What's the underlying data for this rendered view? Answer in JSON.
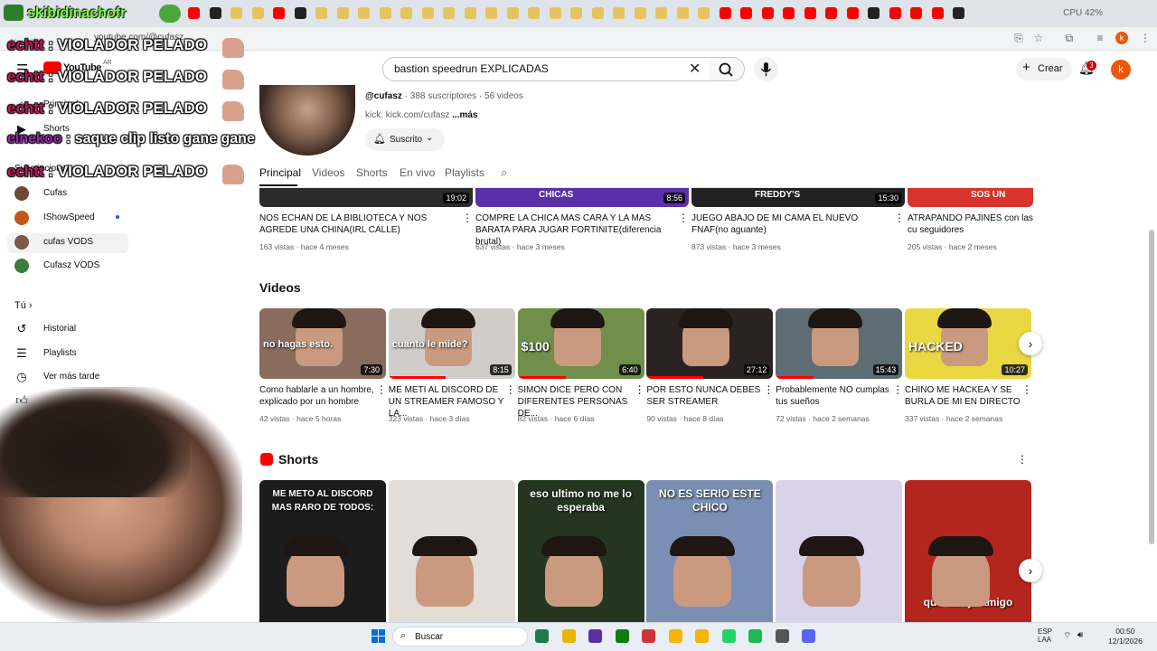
{
  "browser": {
    "stats": "CPU 42%",
    "url": "youtube.com/@cufasz"
  },
  "overlays": {
    "top_label": "skibidinachofr",
    "chat": [
      {
        "user": "echtt",
        "msg": " : VIOLADOR PELADO"
      },
      {
        "user": "echtt",
        "msg": " : VIOLADOR PELADO"
      },
      {
        "user": "echtt",
        "msg": " : VIOLADOR PELADO"
      },
      {
        "user": "elnekoo",
        "msg": " : saque clip listo gane gane"
      },
      {
        "user": "echtt",
        "msg": " : VIOLADOR PELADO"
      }
    ]
  },
  "youtube": {
    "logo": "YouTube",
    "logo_region": "AR",
    "search_value": "bastion speedrun EXPLICADAS",
    "create_label": "Crear",
    "notifications": "3",
    "avatar_letter": "k"
  },
  "sidebar": {
    "items_top": [
      {
        "label": "Principal",
        "icon": "home-icon"
      },
      {
        "label": "Shorts",
        "icon": "shorts-icon"
      }
    ],
    "subs_heading": "Suscripciones",
    "subscriptions": [
      {
        "label": "Cufas",
        "color": "#6b4a3a"
      },
      {
        "label": "IShowSpeed",
        "color": "#c2571a"
      },
      {
        "label": "cufas VODS",
        "color": "#7a5a48"
      },
      {
        "label": "Cufasz VODS",
        "color": "#3b7d3b"
      }
    ],
    "you_heading": "Tú",
    "you_items": [
      {
        "label": "Historial",
        "icon": "history-icon"
      },
      {
        "label": "Playlists",
        "icon": "playlists-icon"
      },
      {
        "label": "Ver más tarde",
        "icon": "watch-later-icon"
      }
    ]
  },
  "channel": {
    "handle": "@cufasz",
    "stats": " · 388 suscriptores · 56 videos",
    "kick": "kick: kick.com/cufasz ",
    "more": "...más",
    "subscribed": "Suscrito",
    "tabs": [
      "Principal",
      "Videos",
      "Shorts",
      "En vivo",
      "Playlists"
    ]
  },
  "row1": [
    {
      "duration": "19:02",
      "title": "NOS ECHAN DE LA BIBLIOTECA Y NOS AGREDE UNA CHINA(IRL CALLE)",
      "meta": "163 vistas · hace 4 meses",
      "color": "#2b2b2b"
    },
    {
      "duration": "8:56",
      "title": "COMPRE LA CHICA MAS CARA Y LA MAS BARATA PARA JUGAR FORTINITE(diferencia brutal)",
      "meta": "637 vistas · hace 3 meses",
      "color": "#5b2fa8",
      "overlay": "CHICAS"
    },
    {
      "duration": "15:30",
      "title": "JUEGO ABAJO DE MI CAMA EL NUEVO FNAF(no aguante)",
      "meta": "873 vistas · hace 3 meses",
      "color": "#222222",
      "overlay": "FREDDY'S"
    },
    {
      "duration": "",
      "title": "ATRAPANDO PAJINES con las cu seguidores",
      "meta": "205 vistas · hace 2 meses",
      "color": "#d8332c",
      "overlay": "SOS UN"
    }
  ],
  "videos_section": {
    "title": "Videos",
    "items": [
      {
        "duration": "7:30",
        "title": "Como hablarle a un hombre, explicado por un hombre",
        "meta": "42 vistas · hace 5 horas",
        "color": "#8a6c5e",
        "overlay": "no hagas esto.",
        "progress": 0
      },
      {
        "duration": "8:15",
        "title": "ME METI AL DISCORD DE UN STREAMER FAMOSO Y LA...",
        "meta": "323 vistas · hace 3 días",
        "color": "#d0cdc8",
        "overlay": "cuanto le mide?",
        "progress": 0.45
      },
      {
        "duration": "6:40",
        "title": "SIMON DICE PERO CON DIFERENTES PERSONAS DE...",
        "meta": "82 vistas · hace 6 días",
        "color": "#6f8f4a",
        "overlay": "$100",
        "progress": 0.38
      },
      {
        "duration": "27:12",
        "title": "POR ESTO NUNCA DEBES SER STREAMER",
        "meta": "90 vistas · hace 8 días",
        "color": "#2a2322",
        "overlay": "",
        "progress": 0.45
      },
      {
        "duration": "15:43",
        "title": "Probablemente NO cumplas tus sueños",
        "meta": "72 vistas · hace 2 semanas",
        "color": "#5e6c74",
        "overlay": "",
        "progress": 0.3
      },
      {
        "duration": "10:27",
        "title": "CHINO ME HACKEA Y SE BURLA DE MI EN DIRECTO",
        "meta": "337 vistas · hace 2 semanas",
        "color": "#e9d842",
        "overlay": "HACKED",
        "progress": 0
      }
    ]
  },
  "shorts_section": {
    "title": "Shorts",
    "items": [
      {
        "overlay": "ME METO AL DISCORD MAS RARO DE TODOS:",
        "color": "#1c1c1c"
      },
      {
        "overlay": "",
        "color": "#e2ddd7"
      },
      {
        "overlay": "eso ultimo no me lo esperaba",
        "color": "#24361f"
      },
      {
        "overlay": "NO ES SERIO ESTE CHICO",
        "color": "#7a8fb3"
      },
      {
        "overlay": "",
        "color": "#d9d3ea"
      },
      {
        "overlay": "que carajo amigo",
        "color": "#b3261e"
      }
    ]
  },
  "taskbar": {
    "search": "Buscar",
    "lang": "ESP",
    "lang2": "LAA",
    "time": "00:50",
    "date": "12/1/2026"
  }
}
